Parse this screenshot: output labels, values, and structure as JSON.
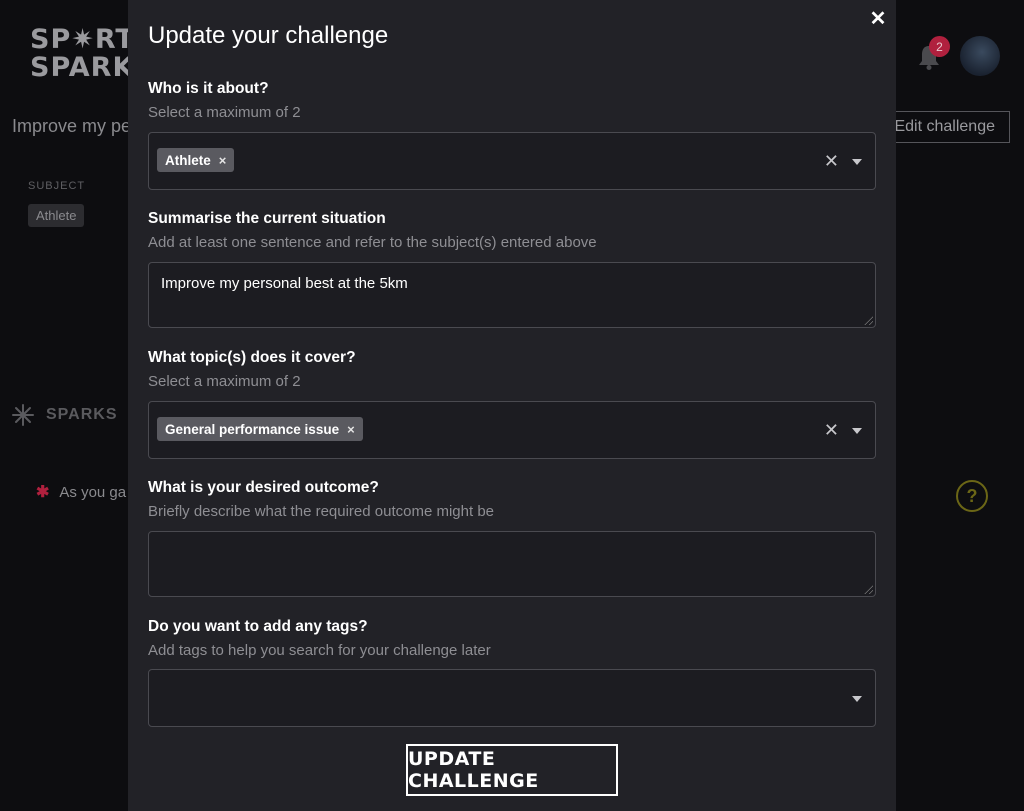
{
  "background": {
    "logo": {
      "line1": "SP✷RT",
      "line2": "SPARKS"
    },
    "challenge_title": "Improve my pe",
    "subject_label": "SUBJECT",
    "subject_chip": "Athlete",
    "sparks_heading": "SPARKS",
    "hint_text": "As you ga",
    "notification_count": "2",
    "edit_button": "Edit challenge",
    "help_icon_glyph": "?"
  },
  "modal": {
    "title": "Update your challenge",
    "close_glyph": "✕",
    "fields": [
      {
        "question": "Who is it about?",
        "hint": "Select a maximum of 2",
        "selected": [
          "Athlete"
        ]
      },
      {
        "question": "Summarise the current situation",
        "hint": "Add at least one sentence and refer to the subject(s) entered above",
        "value": "Improve my personal best at the 5km"
      },
      {
        "question": "What topic(s) does it cover?",
        "hint": "Select a maximum of 2",
        "selected": [
          "General performance issue"
        ]
      },
      {
        "question": "What is your desired outcome?",
        "hint": "Briefly describe what the required outcome might be",
        "value": ""
      },
      {
        "question": "Do you want to add any tags?",
        "hint": "Add tags to help you search for your challenge later",
        "selected": []
      }
    ],
    "chip_remove_glyph": "×",
    "clear_glyph": "✕",
    "submit_label": "UPDATE CHALLENGE"
  },
  "colors": {
    "page_bg": "#0d0d10",
    "modal_bg": "#222227",
    "field_bg": "#1c1c21",
    "accent_red": "#b0203e"
  }
}
